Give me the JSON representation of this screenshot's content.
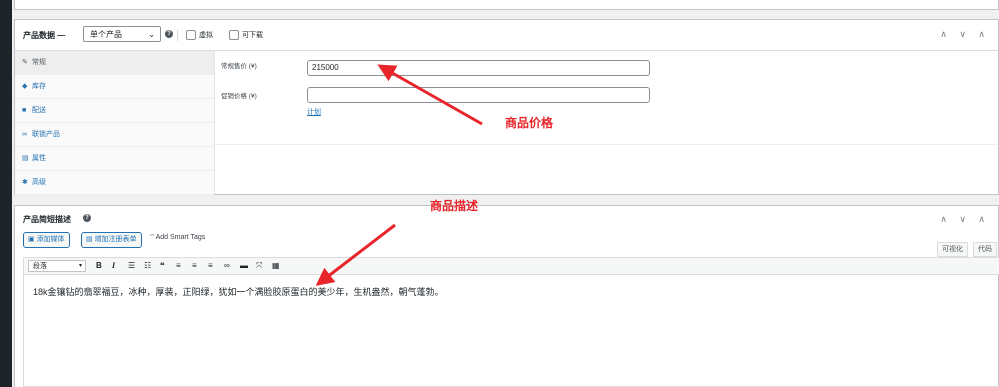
{
  "product_data": {
    "title": "产品数据 —",
    "type_select": "单个产品",
    "help": "?",
    "virtual_label": "虚拟",
    "downloadable_label": "可下载",
    "collapse_arrows": "∧ ∨ ∧",
    "tabs": [
      {
        "label": "常规",
        "icon": "wrench-icon",
        "glyph": "✎"
      },
      {
        "label": "库存",
        "icon": "tag-icon",
        "glyph": "◆"
      },
      {
        "label": "配送",
        "icon": "truck-icon",
        "glyph": "■"
      },
      {
        "label": "联锁产品",
        "icon": "link-icon",
        "glyph": "∞"
      },
      {
        "label": "属性",
        "icon": "table-icon",
        "glyph": "▤"
      },
      {
        "label": "高级",
        "icon": "gear-icon",
        "glyph": "✱"
      }
    ],
    "regular_price_label": "常规售价 (¥)",
    "regular_price_value": "215000",
    "sale_price_label": "促销价格 (¥)",
    "sale_price_value": "",
    "schedule_link": "计划"
  },
  "short_description": {
    "title": "产品简短描述",
    "help": "?",
    "add_media": "添加媒体",
    "add_form": "增加注册表单",
    "smart_tags": "Add Smart Tags",
    "visual_tab": "可视化",
    "code_tab": "代码",
    "format_select": "段落",
    "collapse_arrows": "∧ ∨ ∧",
    "content": "18k金镶钻的翡翠福豆，冰种，厚装，正阳绿，犹如一个满脸胶原蛋白的美少年，生机盎然，朝气蓬勃。"
  },
  "annotations": {
    "price_note": "商品价格",
    "desc_note": "商品描述",
    "color": "#e8252a"
  },
  "toolbar_icons": [
    "bold-icon",
    "italic-icon",
    "bullet-list-icon",
    "numbered-list-icon",
    "quote-icon",
    "align-left-icon",
    "align-center-icon",
    "align-right-icon",
    "link-icon",
    "more-icon",
    "fullscreen-icon",
    "toolbar-toggle-icon"
  ]
}
